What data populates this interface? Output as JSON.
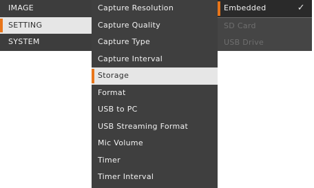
{
  "menu": {
    "categories": [
      "IMAGE",
      "SETTING",
      "SYSTEM"
    ],
    "settings": [
      "Capture Resolution",
      "Capture Quality",
      "Capture Type",
      "Capture Interval",
      "Storage",
      "Format",
      "USB to PC",
      "USB Streaming Format",
      "Mic Volume",
      "Timer",
      "Timer Interval"
    ],
    "storage_options": [
      "Embedded",
      "SD Card",
      "USB Drive"
    ],
    "check_glyph": "✓"
  },
  "colors": {
    "accent": "#e8751a",
    "menu_bg": "#3f3f3f",
    "selected_bg": "#e6e6e6"
  }
}
